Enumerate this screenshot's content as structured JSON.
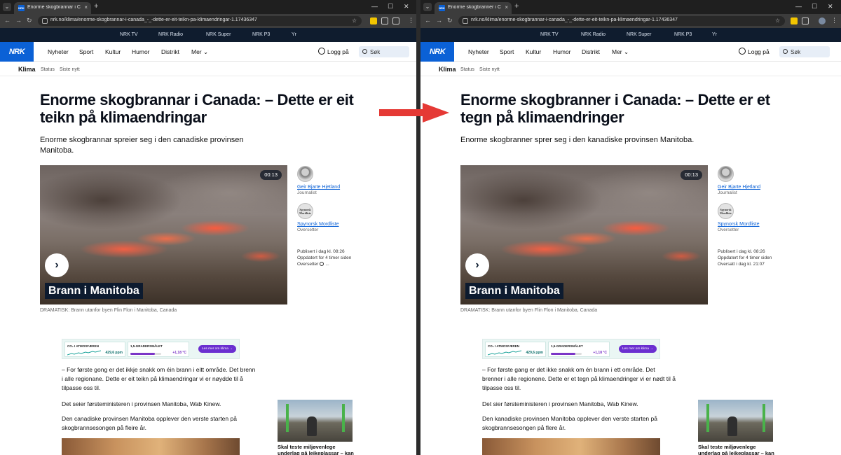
{
  "browser": {
    "left": {
      "tab_title": "Enorme skogbrannar i Canada: ...",
      "url": "nrk.no/klima/enorme-skogbrannar-i-canada_-_-dette-er-eit-teikn-pa-klimaendringar-1.17436347"
    },
    "right": {
      "tab_title": "Enorme skogbranner i Canada: ...",
      "url": "nrk.no/klima/enorme-skogbrannar-i-canada_-_-dette-er-eit-teikn-pa-klimaendringar-1.17436347"
    },
    "tab_close": "×",
    "new_tab": "+",
    "dropdown": "⌄",
    "back": "←",
    "forward": "→",
    "reload": "↻",
    "minimize": "—",
    "maximize": "☐",
    "close": "✕",
    "star": "☆",
    "kebab": "⋮"
  },
  "services": [
    "NRK TV",
    "NRK Radio",
    "NRK Super",
    "NRK P3",
    "Yr"
  ],
  "header": {
    "logo": "NRK",
    "nav": [
      "Nyheter",
      "Sport",
      "Kultur",
      "Humor",
      "Distrikt",
      "Mer ⌄"
    ],
    "login": "Logg på",
    "search_placeholder": "Søk"
  },
  "subnav": {
    "main": "Klima",
    "links": [
      "Status",
      "Siste nytt"
    ]
  },
  "video": {
    "duration": "00:13",
    "play": "›",
    "label": "Brann i Manitoba",
    "caption": "DRAMATISK: Brann utanfor byen Flin Flon i Manitoba, Canada"
  },
  "byline": {
    "journalist_name": "Geir Bjarte Hjetland",
    "journalist_role": "Journalist",
    "translator_logo": "Spynorsk Mordliste",
    "translator_name": "Spynorsk Mordliste",
    "translator_role": "Oversetter"
  },
  "climate": {
    "co2_label": "CO₂ I ATMOSFÆREN",
    "co2_value": "429,6 ppm",
    "deg_label": "1,5-GRADERSMÅLET",
    "deg_value": "+1,18 °C",
    "deg_progress": 0.79,
    "cta": "Les mer om klima →"
  },
  "related": {
    "title": "Skal teste miljøvenlege underlag på leikeplassar – kan"
  },
  "left": {
    "title": "Enorme skogbrannar i Canada: – Dette er eit teikn på klimaendringar",
    "lead": "Enorme skogbrannar spreier seg i den canadiske provinsen Manitoba.",
    "meta": {
      "published": "Publisert i dag kl. 08:26",
      "updated": "Oppdatert for 4 timer siden",
      "translator": "Oversetter",
      "ellipsis": "..."
    },
    "paragraphs": [
      "– For første gong er det ikkje snakk om éin brann i eitt område. Det brenn i alle regionane. Dette er eit teikn på klimaendringar vi er nøydde til å tilpasse oss til.",
      "Det seier førsteministeren i provinsen Manitoba, Wab Kinew.",
      "Den canadiske provinsen Manitoba opplever den verste starten på skogbrannsesongen på fleire år."
    ]
  },
  "right": {
    "title": "Enorme skogbranner i Canada: – Dette er et tegn på klimaendringer",
    "lead": "Enorme skogbranner sprer seg i den kanadiske provinsen Manitoba.",
    "meta": {
      "published": "Publisert i dag kl. 08:26",
      "updated": "Oppdatert for 4 timer siden",
      "translated": "Oversatt i dag kl. 21:07"
    },
    "paragraphs": [
      "– For første gang er det ikke snakk om én brann i ett område. Det brenner i alle regionene. Dette er et tegn på klimaendringer vi er nødt til å tilpasse oss til.",
      "Det sier førsteministeren i provinsen Manitoba, Wab Kinew.",
      "Den kanadiske provinsen Manitoba opplever den verste starten på skogbrannsesongen på flere år."
    ]
  },
  "colors": {
    "nrk_blue": "#0b61d6",
    "service_bar": "#0f1c2e",
    "arrow_red": "#e53935",
    "climate_purple": "#6b2fd0"
  }
}
